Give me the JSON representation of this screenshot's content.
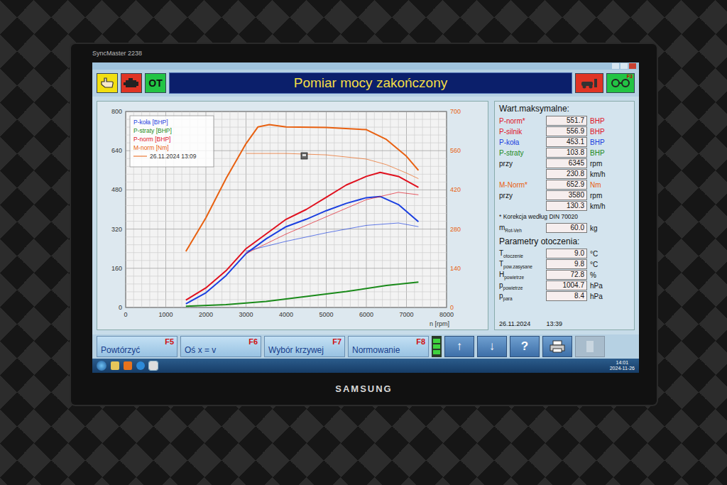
{
  "monitor": {
    "model": "SyncMaster 2238",
    "brand": "SAMSUNG"
  },
  "window": {
    "title": "Pomiar mocy zakończony"
  },
  "toolbar": {
    "left_key": "OT",
    "right_key": "F3"
  },
  "chart": {
    "left_ticks": [
      "0",
      "160",
      "320",
      "480",
      "640",
      "800"
    ],
    "right_ticks": [
      "0",
      "140",
      "280",
      "420",
      "560",
      "700"
    ],
    "x_ticks": [
      "0",
      "1000",
      "2000",
      "3000",
      "4000",
      "5000",
      "6000",
      "7000",
      "8000"
    ],
    "x_label": "n [rpm]",
    "legend": [
      {
        "label": "P-koła [BHP]",
        "color": "#1a3fe0"
      },
      {
        "label": "P-straty [BHP]",
        "color": "#1a8a1a"
      },
      {
        "label": "P-norm [BHP]",
        "color": "#e0101e"
      },
      {
        "label": "M-norm [Nm]",
        "color": "#e86010"
      }
    ],
    "reference_label": "26.11.2024 13:09",
    "series": [
      {
        "name": "M-norm",
        "kind": "measured",
        "axis": "right",
        "color": "#e86010",
        "rpm": [
          1500,
          2000,
          2500,
          3000,
          3300,
          3580,
          4000,
          5000,
          6000,
          6500,
          7000,
          7300
        ],
        "values": [
          200,
          320,
          460,
          585,
          645,
          652.9,
          645,
          643,
          635,
          600,
          540,
          490
        ]
      },
      {
        "name": "P-norm",
        "kind": "measured",
        "axis": "left",
        "color": "#e0101e",
        "rpm": [
          1500,
          2000,
          2500,
          3000,
          3500,
          4000,
          4500,
          5000,
          5500,
          6000,
          6345,
          6800,
          7300
        ],
        "values": [
          30,
          80,
          150,
          240,
          300,
          360,
          400,
          450,
          500,
          535,
          551.7,
          535,
          490
        ]
      },
      {
        "name": "P-koła",
        "kind": "measured",
        "axis": "left",
        "color": "#1a3fe0",
        "rpm": [
          1500,
          2000,
          2500,
          3000,
          3500,
          4000,
          4500,
          5000,
          5500,
          6000,
          6345,
          6800,
          7300
        ],
        "values": [
          15,
          60,
          130,
          220,
          280,
          330,
          360,
          395,
          425,
          448,
          453.1,
          420,
          350
        ]
      },
      {
        "name": "P-straty",
        "kind": "measured",
        "axis": "left",
        "color": "#1a8a1a",
        "rpm": [
          1500,
          2500,
          3500,
          4500,
          5500,
          6500,
          7300
        ],
        "values": [
          5,
          12,
          25,
          45,
          65,
          90,
          103.8
        ]
      },
      {
        "name": "M-norm ref",
        "kind": "reference",
        "axis": "right",
        "color": "#e86010",
        "rpm": [
          3000,
          4000,
          5000,
          6000,
          6500,
          7000,
          7300
        ],
        "values": [
          550,
          550,
          545,
          530,
          510,
          480,
          460
        ]
      },
      {
        "name": "P-norm ref",
        "kind": "reference",
        "axis": "left",
        "color": "#e0101e",
        "rpm": [
          3000,
          4000,
          5000,
          6000,
          6800,
          7300
        ],
        "values": [
          220,
          300,
          370,
          440,
          470,
          460
        ]
      },
      {
        "name": "P-koła ref",
        "kind": "reference",
        "axis": "left",
        "color": "#1a3fe0",
        "rpm": [
          3000,
          4000,
          5000,
          6000,
          6800,
          7300
        ],
        "values": [
          230,
          270,
          305,
          335,
          345,
          330
        ]
      }
    ]
  },
  "maxima": {
    "title": "Wart.maksymalne:",
    "groups": [
      {
        "kind": "value",
        "label": "P-norm*",
        "value": "551.7",
        "unit": "BHP",
        "color": "#e0101e"
      },
      {
        "kind": "value",
        "label": "P-silnik",
        "value": "556.9",
        "unit": "BHP",
        "color": "#e0101e"
      },
      {
        "kind": "value",
        "label": "P-koła",
        "value": "453.1",
        "unit": "BHP",
        "color": "#1a3fe0"
      },
      {
        "kind": "value",
        "label": "P-straty",
        "value": "103.8",
        "unit": "BHP",
        "color": "#1a8a1a"
      },
      {
        "kind": "at",
        "label": "przy",
        "values": [
          {
            "value": "6345",
            "unit": "rpm"
          },
          {
            "value": "230.8",
            "unit": "km/h"
          }
        ]
      },
      {
        "kind": "value",
        "label": "M-Norm*",
        "value": "652.9",
        "unit": "Nm",
        "color": "#e86010"
      },
      {
        "kind": "at",
        "label": "przy",
        "values": [
          {
            "value": "3580",
            "unit": "rpm"
          },
          {
            "value": "130.3",
            "unit": "km/h"
          }
        ]
      }
    ],
    "note": "* Korekcja według DIN 70020",
    "mass": {
      "label": "m",
      "sub": "Rot-Veh",
      "value": "60.0",
      "unit": "kg"
    }
  },
  "ambient": {
    "title": "Parametry otoczenia:",
    "rows": [
      {
        "label": "T",
        "sub": "otoczenie",
        "value": "9.0",
        "unit": "°C"
      },
      {
        "label": "T",
        "sub": "pow.zasysane",
        "value": "9.8",
        "unit": "°C"
      },
      {
        "label": "H",
        "sub": "powietrze",
        "value": "72.8",
        "unit": "%"
      },
      {
        "label": "p",
        "sub": "powietrze",
        "value": "1004.7",
        "unit": "hPa"
      },
      {
        "label": "p",
        "sub": "para",
        "value": "8.4",
        "unit": "hPa"
      }
    ],
    "date": "26.11.2024",
    "time": "13:39"
  },
  "function_buttons": [
    {
      "label": "Powtórzyć",
      "key": "F5"
    },
    {
      "label": "Oś x = v",
      "key": "F6"
    },
    {
      "label": "Wybór krzywej",
      "key": "F7"
    },
    {
      "label": "Normowanie",
      "key": "F8"
    }
  ],
  "tool_buttons": [
    {
      "kind": "glyph",
      "glyph": "↑",
      "disabled": false
    },
    {
      "kind": "glyph",
      "glyph": "↓",
      "disabled": false
    },
    {
      "kind": "glyph",
      "glyph": "?",
      "disabled": false
    },
    {
      "kind": "printer",
      "disabled": false
    },
    {
      "kind": "blank",
      "disabled": true
    }
  ],
  "taskbar": {
    "time": "14:01",
    "date": "2024-11-26"
  }
}
